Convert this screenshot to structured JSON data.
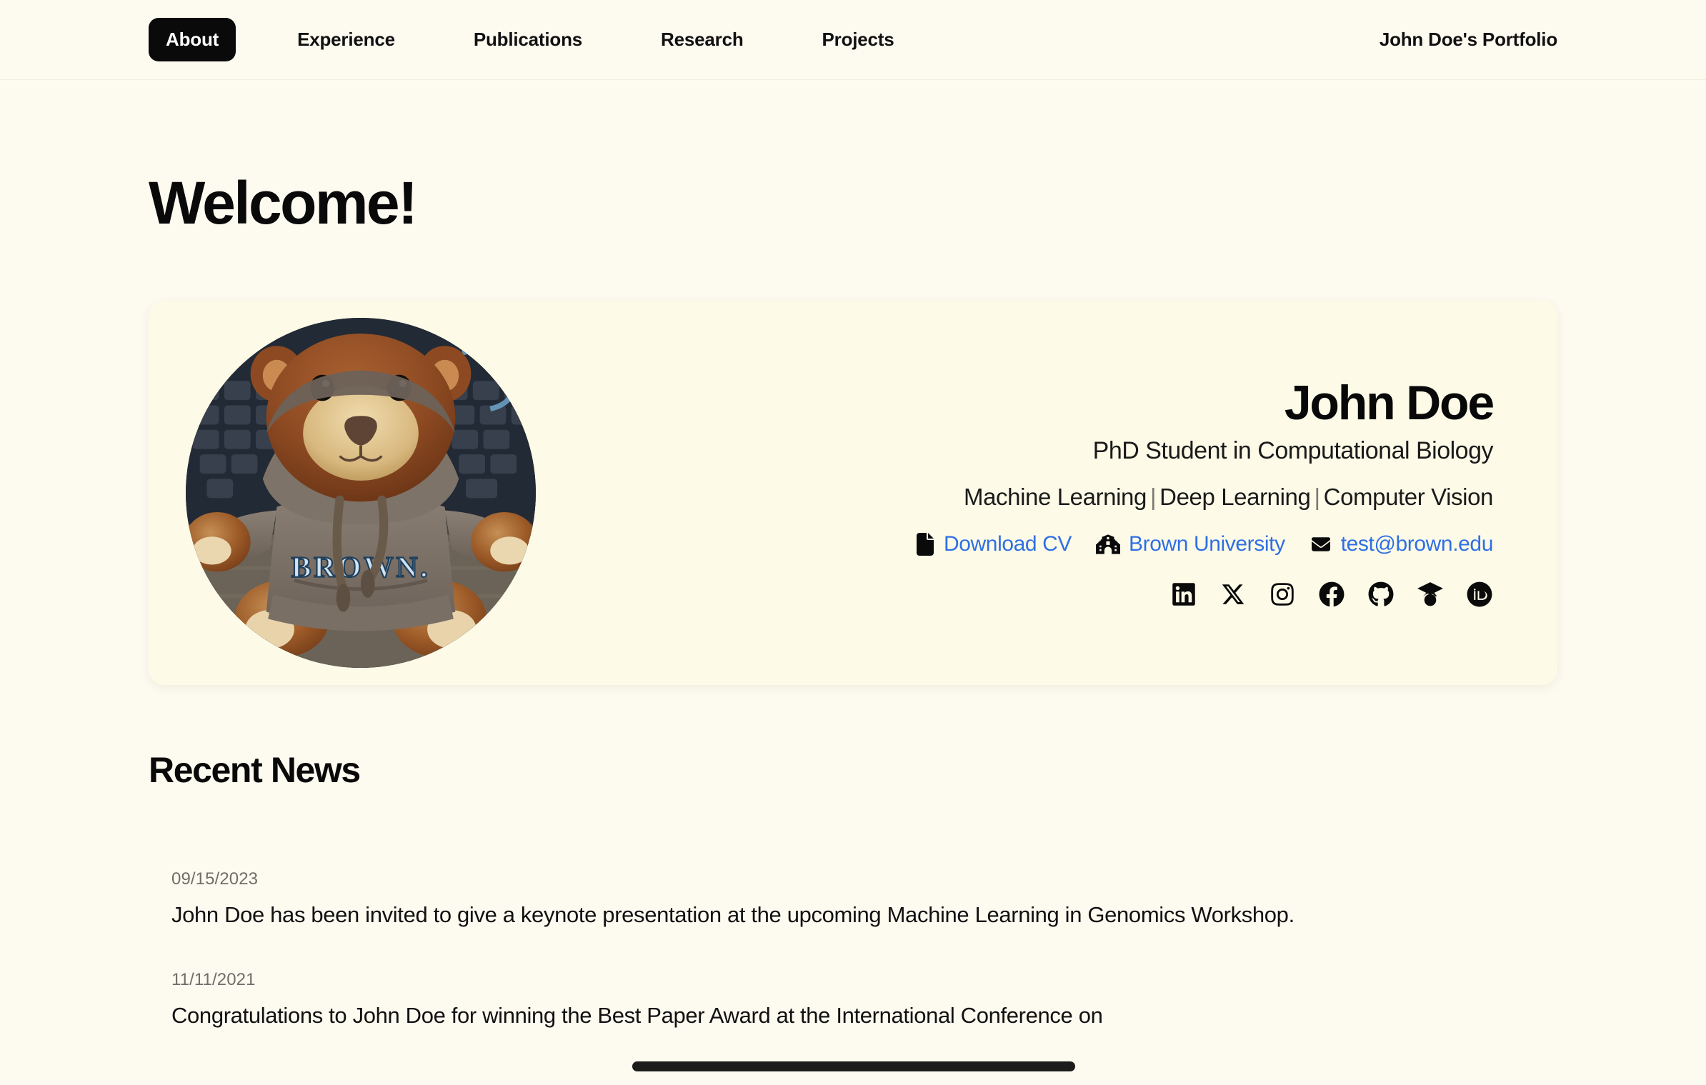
{
  "nav": {
    "items": [
      {
        "label": "About",
        "active": true
      },
      {
        "label": "Experience",
        "active": false
      },
      {
        "label": "Publications",
        "active": false
      },
      {
        "label": "Research",
        "active": false
      },
      {
        "label": "Projects",
        "active": false
      }
    ],
    "brand": "John Doe's Portfolio"
  },
  "hero": {
    "welcome_heading": "Welcome!",
    "avatar_alt": "Teddy bear wearing a Brown University hoodie sitting on a keyboard",
    "name": "John Doe",
    "role": "PhD Student in Computational Biology",
    "topics": [
      "Machine Learning",
      "Deep Learning",
      "Computer Vision"
    ],
    "topic_separator": "|",
    "contact_links": [
      {
        "icon": "file-icon",
        "label": "Download CV"
      },
      {
        "icon": "university-icon",
        "label": "Brown University"
      },
      {
        "icon": "envelope-icon",
        "label": "test@brown.edu"
      }
    ],
    "social_links": [
      {
        "icon": "linkedin-icon",
        "label": "LinkedIn"
      },
      {
        "icon": "x-twitter-icon",
        "label": "X"
      },
      {
        "icon": "instagram-icon",
        "label": "Instagram"
      },
      {
        "icon": "facebook-icon",
        "label": "Facebook"
      },
      {
        "icon": "github-icon",
        "label": "GitHub"
      },
      {
        "icon": "google-scholar-icon",
        "label": "Google Scholar"
      },
      {
        "icon": "orcid-icon",
        "label": "ORCID"
      }
    ]
  },
  "news": {
    "heading": "Recent News",
    "items": [
      {
        "date": "09/15/2023",
        "text": "John Doe has been invited to give a keynote presentation at the upcoming Machine Learning in Genomics Workshop."
      },
      {
        "date": "11/11/2021",
        "text": "Congratulations to John Doe for winning the Best Paper Award at the International Conference on"
      }
    ]
  },
  "colors": {
    "page_background": "#fdfaf0",
    "card_background": "#fdfbe8",
    "link_blue": "#2f6fe4",
    "text_black": "#111111",
    "muted_gray": "#6f6f68",
    "pill_black": "#0a0a0a"
  }
}
